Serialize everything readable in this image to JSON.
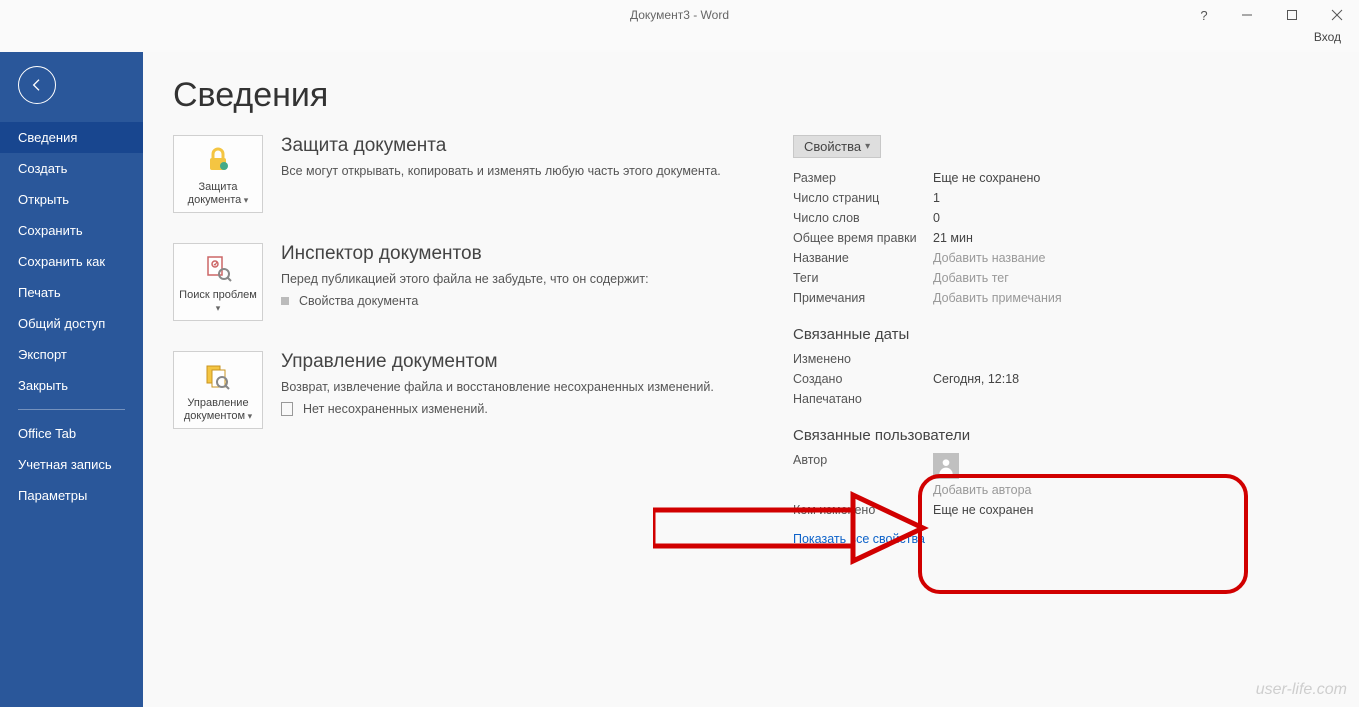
{
  "titlebar": {
    "title": "Документ3 - Word",
    "signin": "Вход"
  },
  "sidebar": {
    "items": [
      "Сведения",
      "Создать",
      "Открыть",
      "Сохранить",
      "Сохранить как",
      "Печать",
      "Общий доступ",
      "Экспорт",
      "Закрыть"
    ],
    "items2": [
      "Office Tab",
      "Учетная запись",
      "Параметры"
    ]
  },
  "page": {
    "title": "Сведения"
  },
  "sections": {
    "protect": {
      "btn": "Защита документа",
      "head": "Защита документа",
      "desc": "Все могут открывать, копировать и изменять любую часть этого документа."
    },
    "inspect": {
      "btn": "Поиск проблем",
      "head": "Инспектор документов",
      "desc": "Перед публикацией этого файла не забудьте, что он содержит:",
      "bullet": "Свойства документа"
    },
    "manage": {
      "btn": "Управление документом",
      "head": "Управление документом",
      "desc": "Возврат, извлечение файла и восстановление несохраненных изменений.",
      "bullet": "Нет несохраненных изменений."
    }
  },
  "props": {
    "btn": "Свойства",
    "rows": {
      "size": {
        "k": "Размер",
        "v": "Еще не сохранено"
      },
      "pages": {
        "k": "Число страниц",
        "v": "1"
      },
      "words": {
        "k": "Число слов",
        "v": "0"
      },
      "edittime": {
        "k": "Общее время правки",
        "v": "21 мин"
      },
      "title": {
        "k": "Название",
        "v": "Добавить название"
      },
      "tags": {
        "k": "Теги",
        "v": "Добавить тег"
      },
      "comments": {
        "k": "Примечания",
        "v": "Добавить примечания"
      }
    },
    "dates_head": "Связанные даты",
    "dates": {
      "modified": {
        "k": "Изменено",
        "v": ""
      },
      "created": {
        "k": "Создано",
        "v": "Сегодня, 12:18"
      },
      "printed": {
        "k": "Напечатано",
        "v": ""
      }
    },
    "users_head": "Связанные пользователи",
    "users": {
      "author": {
        "k": "Автор",
        "add": "Добавить автора"
      },
      "lastmod": {
        "k": "Кем изменено",
        "v": "Еще не сохранен"
      }
    },
    "show_all": "Показать все свойства"
  },
  "watermark": "user-life.com"
}
